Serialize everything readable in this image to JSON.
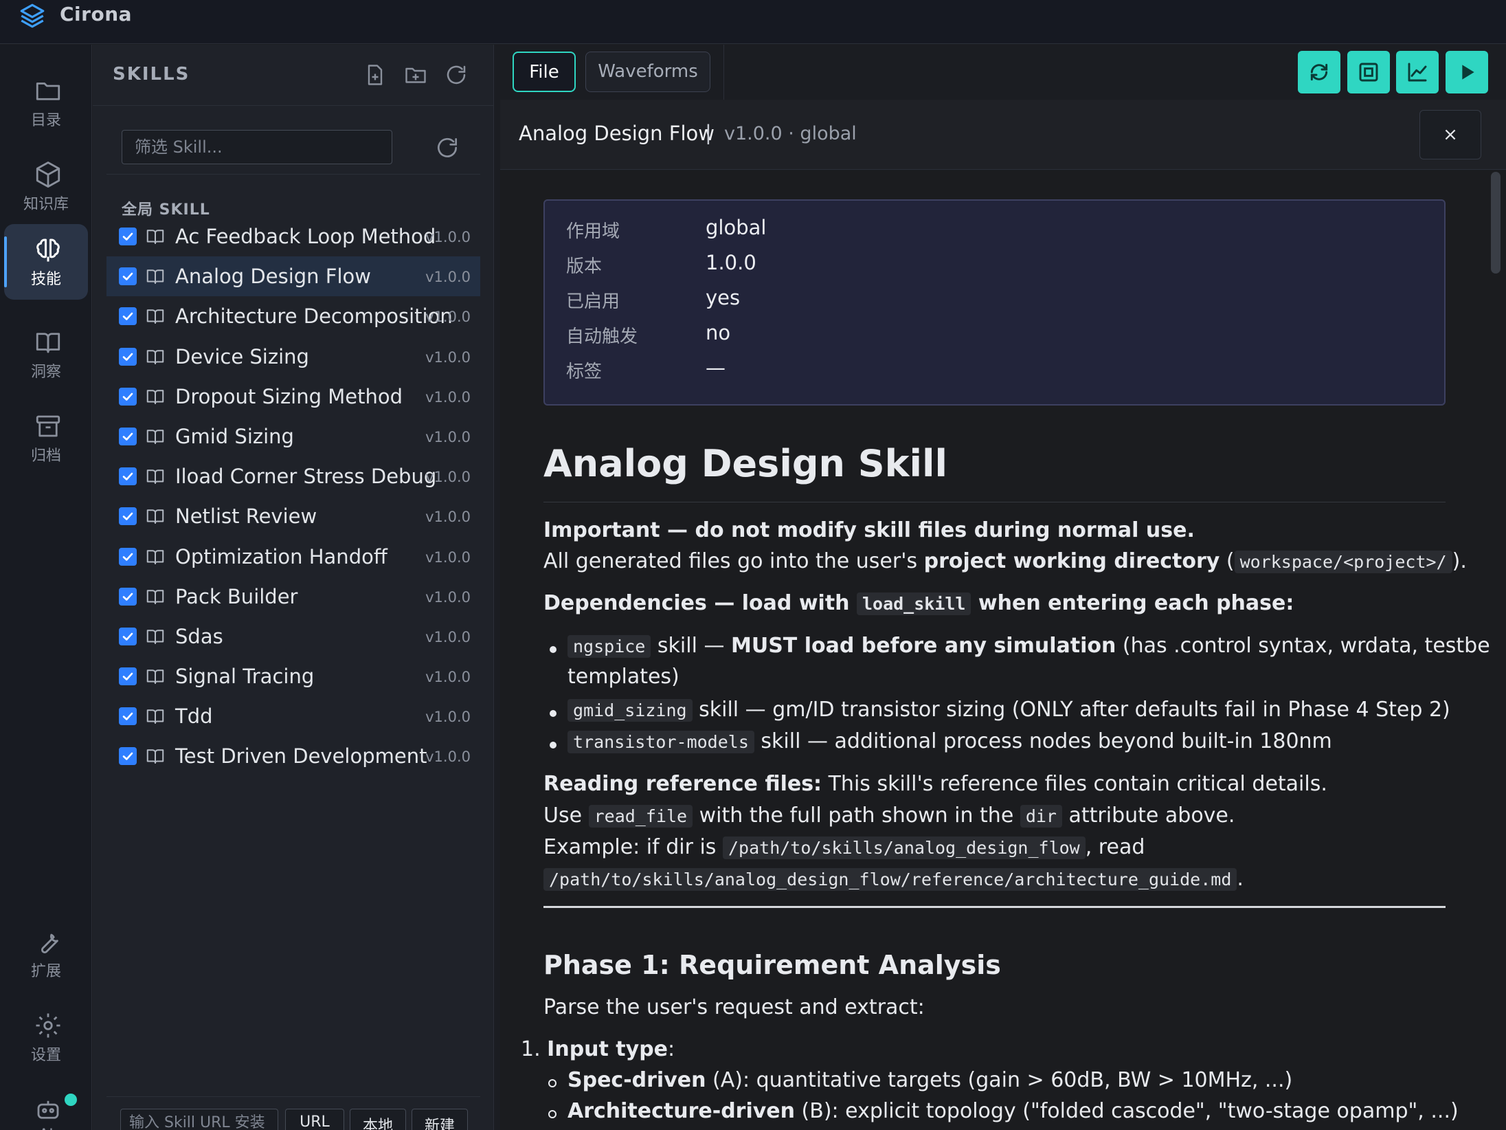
{
  "app": {
    "title": "Cirona"
  },
  "rail": {
    "items": [
      {
        "label": "目录",
        "icon": "folder-icon"
      },
      {
        "label": "知识库",
        "icon": "cube-icon"
      },
      {
        "label": "技能",
        "icon": "brain-icon",
        "active": true
      },
      {
        "label": "洞察",
        "icon": "book-icon"
      },
      {
        "label": "归档",
        "icon": "archive-icon"
      }
    ],
    "bottom": [
      {
        "label": "扩展",
        "icon": "wrench-icon"
      },
      {
        "label": "设置",
        "icon": "gear-icon"
      },
      {
        "label": "AI",
        "icon": "robot-icon"
      }
    ]
  },
  "skills": {
    "title": "SKILLS",
    "filter_placeholder": "筛选 Skill...",
    "group_label": "全局 SKILL",
    "items": [
      {
        "name": "Ac Feedback Loop Method",
        "version": "v1.0.0",
        "checked": true
      },
      {
        "name": "Analog Design Flow",
        "version": "v1.0.0",
        "checked": true,
        "selected": true
      },
      {
        "name": "Architecture Decomposition",
        "version": "v1.0.0",
        "checked": true
      },
      {
        "name": "Device Sizing",
        "version": "v1.0.0",
        "checked": true
      },
      {
        "name": "Dropout Sizing Method",
        "version": "v1.0.0",
        "checked": true
      },
      {
        "name": "Gmid Sizing",
        "version": "v1.0.0",
        "checked": true
      },
      {
        "name": "Iload Corner Stress Debug",
        "version": "v1.0.0",
        "checked": true
      },
      {
        "name": "Netlist Review",
        "version": "v1.0.0",
        "checked": true
      },
      {
        "name": "Optimization Handoff",
        "version": "v1.0.0",
        "checked": true
      },
      {
        "name": "Pack Builder",
        "version": "v1.0.0",
        "checked": true
      },
      {
        "name": "Sdas",
        "version": "v1.0.0",
        "checked": true
      },
      {
        "name": "Signal Tracing",
        "version": "v1.0.0",
        "checked": true
      },
      {
        "name": "Tdd",
        "version": "v1.0.0",
        "checked": true
      },
      {
        "name": "Test Driven Development",
        "version": "v1.0.0",
        "checked": true
      }
    ],
    "bottom": {
      "url_placeholder": "输入 Skill URL 安装",
      "url_button": "URL",
      "local_button": "本地",
      "new_button": "新建"
    }
  },
  "tabs": {
    "file": "File",
    "waveforms": "Waveforms"
  },
  "toolbar": [
    "refresh-icon",
    "fit-icon",
    "chart-icon",
    "play-icon"
  ],
  "doc": {
    "title": "Analog Design Flow",
    "separator": "|",
    "meta": "v1.0.0 · global",
    "close": "×",
    "info": [
      {
        "key": "作用域",
        "value": "global"
      },
      {
        "key": "版本",
        "value": "1.0.0"
      },
      {
        "key": "已启用",
        "value": "yes"
      },
      {
        "key": "自动触发",
        "value": "no"
      },
      {
        "key": "标签",
        "value": "—"
      }
    ],
    "h1": "Analog Design Skill",
    "important": "Important — do not modify skill files during normal use.",
    "generated_pre": "All generated files go into the user's ",
    "generated_bold": "project working directory",
    "generated_mid": " (",
    "generated_code": "workspace/<project>/",
    "generated_post": ").",
    "deps_pre": "Dependencies — load with ",
    "deps_code": "load_skill",
    "deps_post": " when entering each phase:",
    "dep1_code": "ngspice",
    "dep1_mid": " skill — ",
    "dep1_bold": "MUST load before any simulation",
    "dep1_post": " (has .control syntax, wrdata, testbench",
    "dep1_cont": "templates)",
    "dep2_code": "gmid_sizing",
    "dep2_post": " skill — gm/ID transistor sizing (ONLY after defaults fail in Phase 4 Step 2)",
    "dep3_code": "transistor-models",
    "dep3_post": " skill — additional process nodes beyond built-in 180nm",
    "ref_bold": "Reading reference files:",
    "ref_post": " This skill's reference files contain critical details.",
    "use_pre": "Use ",
    "use_code": "read_file",
    "use_mid": " with the full path shown in the ",
    "use_code2": "dir",
    "use_post": " attribute above.",
    "ex_pre": "Example: if dir is ",
    "ex_code": "/path/to/skills/analog_design_flow",
    "ex_post": ", read",
    "ex_code2": "/path/to/skills/analog_design_flow/reference/architecture_guide.md",
    "ex_end": ".",
    "h2": "Phase 1: Requirement Analysis",
    "parse": "Parse the user's request and extract:",
    "ol1_num": "1.",
    "ol1_bold": "Input type",
    "ol1_post": ":",
    "sub1_bold": "Spec-driven",
    "sub1_post": " (A): quantitative targets (gain > 60dB, BW > 10MHz, ...)",
    "sub2_bold": "Architecture-driven",
    "sub2_post": " (B): explicit topology (\"folded cascode\", \"two-stage opamp\", ...)"
  }
}
